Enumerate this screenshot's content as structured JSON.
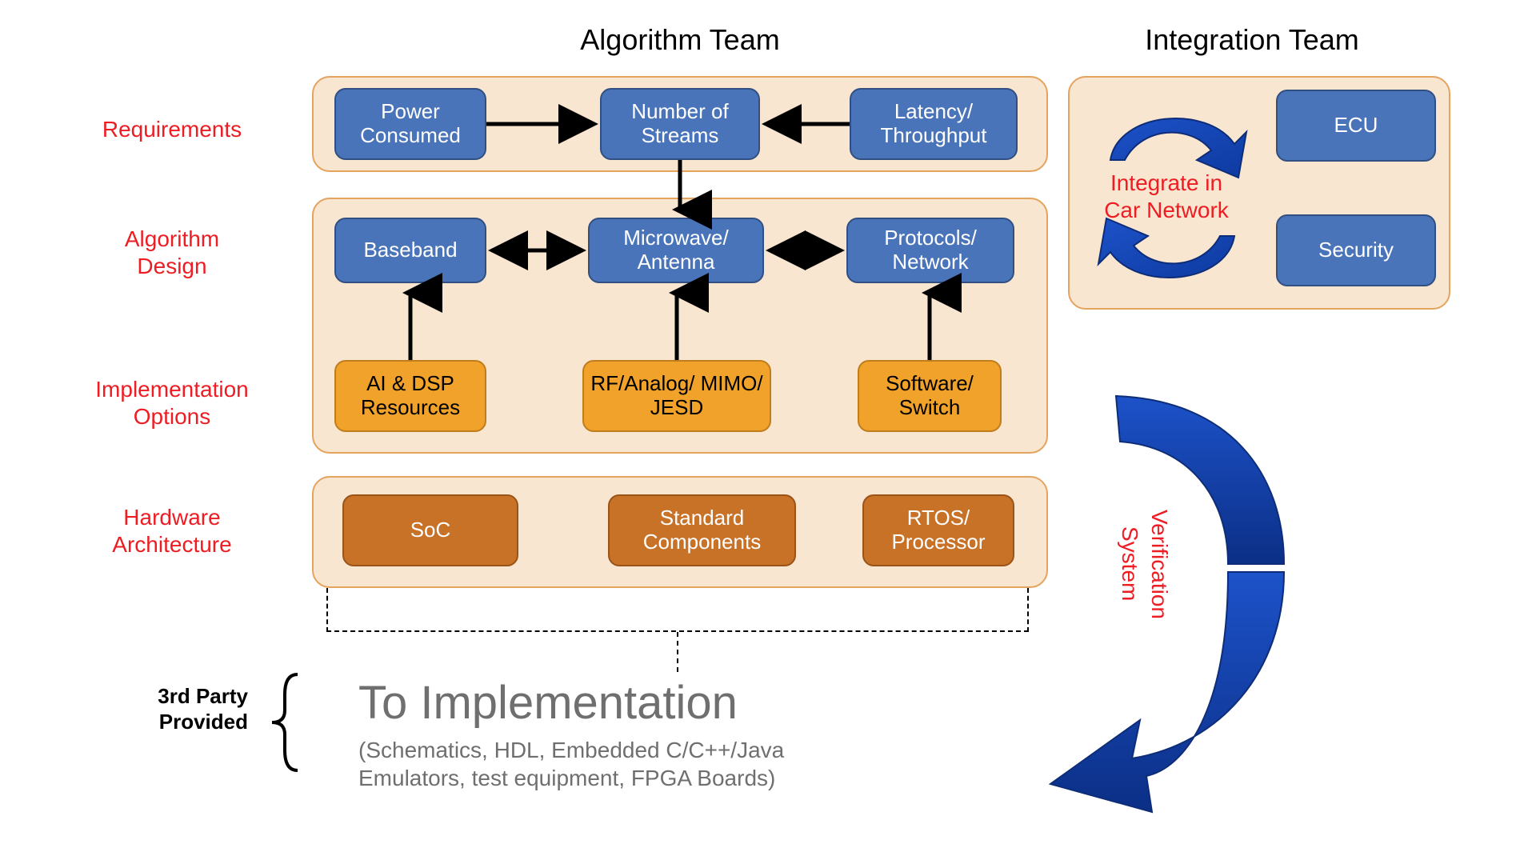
{
  "headers": {
    "algorithm": "Algorithm Team",
    "integration": "Integration Team"
  },
  "rowLabels": {
    "requirements": "Requirements",
    "algDesign1": "Algorithm",
    "algDesign2": "Design",
    "implOpt1": "Implementation",
    "implOpt2": "Options",
    "hw1": "Hardware",
    "hw2": "Architecture"
  },
  "boxes": {
    "power": "Power Consumed",
    "streams": "Number of Streams",
    "latency": "Latency/ Throughput",
    "baseband": "Baseband",
    "microwave": "Microwave/ Antenna",
    "protocols": "Protocols/ Network",
    "aidsp": "AI & DSP Resources",
    "rf": "RF/Analog/ MIMO/ JESD",
    "softswitch": "Software/ Switch",
    "soc": "SoC",
    "stdcomp": "Standard Components",
    "rtos": "RTOS/ Processor",
    "ecu": "ECU",
    "security": "Security"
  },
  "integration": {
    "l1": "Integrate in",
    "l2": "Car Network"
  },
  "sysver": {
    "l1": "System",
    "l2": "Verification"
  },
  "thirdParty": {
    "l1": "3rd Party",
    "l2": "Provided"
  },
  "toImpl": {
    "title": "To Implementation",
    "sub1": "(Schematics, HDL, Embedded C/C++/Java",
    "sub2": "Emulators, test equipment, FPGA Boards)"
  }
}
